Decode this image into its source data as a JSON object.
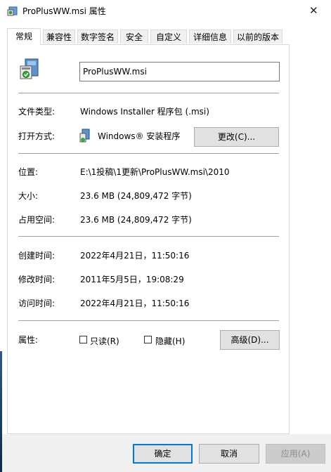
{
  "window": {
    "title": "ProPlusWW.msi 属性",
    "close_glyph": "✕"
  },
  "tabs": [
    {
      "label": "常规",
      "active": true
    },
    {
      "label": "兼容性"
    },
    {
      "label": "数字签名"
    },
    {
      "label": "安全"
    },
    {
      "label": "自定义"
    },
    {
      "label": "详细信息"
    },
    {
      "label": "以前的版本"
    }
  ],
  "general": {
    "file_name": "ProPlusWW.msi",
    "file_type_label": "文件类型:",
    "file_type_value": "Windows Installer 程序包 (.msi)",
    "open_with_label": "打开方式:",
    "open_with_value": "Windows® 安装程序",
    "change_button": "更改(C)...",
    "location_label": "位置:",
    "location_value": "E:\\1投稿\\1更新\\ProPlusWW.msi\\2010",
    "size_label": "大小:",
    "size_value": "23.6 MB (24,809,472 字节)",
    "size_on_disk_label": "占用空间:",
    "size_on_disk_value": "23.6 MB (24,809,472 字节)",
    "created_label": "创建时间:",
    "created_value": "2022年4月21日，11:50:16",
    "modified_label": "修改时间:",
    "modified_value": "2011年5月5日，19:08:29",
    "accessed_label": "访问时间:",
    "accessed_value": "2022年4月21日，11:50:16",
    "attributes_label": "属性:",
    "readonly_label": "只读(R)",
    "hidden_label": "隐藏(H)",
    "advanced_button": "高级(D)..."
  },
  "footer": {
    "ok": "确定",
    "cancel": "取消",
    "apply": "应用(A)"
  },
  "icons": {
    "app": "msi-package-icon",
    "installer": "windows-installer-icon"
  }
}
